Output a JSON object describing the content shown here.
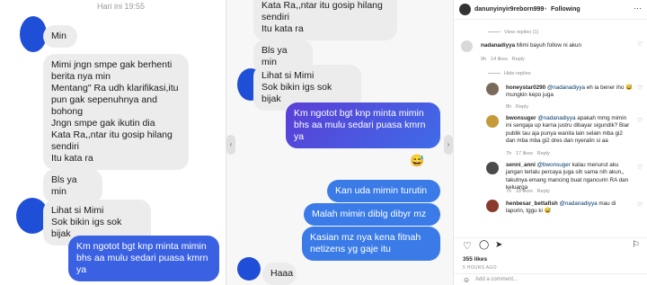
{
  "chat1": {
    "timestamp": "Hari ini 19:55",
    "messages": [
      "Min",
      "Mimi jngn smpe gak berhenti\nberita nya min\nMentang\" Ra udh klarifikasi,itu\npun gak sepenuhnya and\nbohong\nJngn smpe gak ikutin dia\nKata Ra,,ntar itu gosip hilang\nsendiri\nItu kata ra",
      "Bls ya min",
      "Lihat si Mimi\nSok bikin igs sok bijak",
      "Km ngotot bgt knp minta mimin\nbhs aa mulu sedari puasa kmrn\nya"
    ]
  },
  "chat2": {
    "messages_in_top": "Kata Ra,,ntar itu gosip hilang\nsendiri\nItu kata ra",
    "bls": "Bls ya min",
    "lihat": "Lihat si Mimi\nSok bikin igs sok bijak",
    "out1": "Km ngotot bgt knp minta mimin\nbhs aa mulu sedari puasa kmrn\nya",
    "emoji": "😅",
    "out2": "Kan uda mimin turutin",
    "out3": "Malah mimin diblg dibyr mz",
    "out4": "Kasian mz nya kena fitnah\nnetizens yg gaje itu",
    "haaa": "Haaa"
  },
  "instagram": {
    "username": "danunyinyir9reborn999",
    "following": "Following",
    "view_replies_top": "View replies (1)",
    "comment_main": {
      "user": "nadanadiyya",
      "text": "Mimi bayuh follow ni akun",
      "time": "9h",
      "likes": "14 likes",
      "reply": "Reply"
    },
    "hide_replies": "Hide replies",
    "replies": [
      {
        "user": "honeystar0290",
        "mention": "@nadanadiyya",
        "text": "eh ia bener iho 😅 mungkin kepo juga",
        "time": "8h",
        "likes": "",
        "reply": "Reply"
      },
      {
        "user": "bwonsuger",
        "mention": "@nadanadiyya",
        "text": "apakah mmg mimin ini sengaja up karna justru dibayar sigundik? Biar publik tau aja punya wanita lain selain mba gi2 dan mba mba gi2 dres dan nyeralin si aa",
        "time": "7h",
        "likes": "17 likes",
        "reply": "Reply"
      },
      {
        "user": "senni_anni",
        "mention": "@bwonsuger",
        "text": "kalau menurut aku jangan terlalu percaya juga sih sama nih akun,, takutnya emang mancing buat ngancurin RA dan keluarga",
        "time": "7h",
        "likes": "18 likes",
        "reply": "Reply"
      },
      {
        "user": "henbesar_bettafish",
        "mention": "@nadanadiyya",
        "text": "mau di laporin, tggu ki 😅",
        "time": "",
        "likes": "",
        "reply": ""
      }
    ],
    "likes_total": "355 likes",
    "posted": "5 HOURS AGO",
    "add_comment": "Add a comment..."
  },
  "colors": {
    "bubble_out": "#3b61e3",
    "bubble_in": "#ececec",
    "blob": "#1f4fd6",
    "mention": "#00376b"
  }
}
